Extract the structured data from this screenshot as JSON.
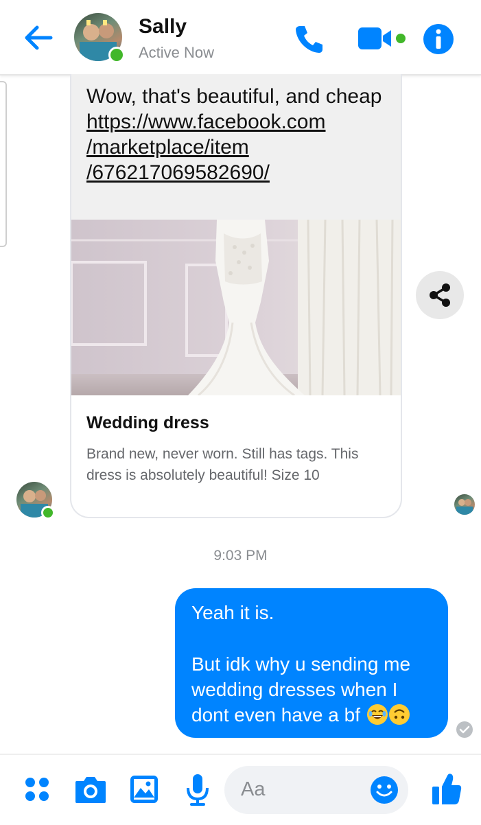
{
  "header": {
    "contact_name": "Sally",
    "status": "Active Now",
    "back_icon": "back-arrow-icon",
    "call_icon": "phone-icon",
    "video_icon": "video-camera-icon",
    "info_icon": "info-icon",
    "accent_color": "#0084ff",
    "online_color": "#42b72a"
  },
  "received_message": {
    "text": "Wow, that's beautiful, and cheap",
    "link_lines": [
      "https://www.facebook.com",
      "/marketplace/item",
      "/676217069582690/"
    ],
    "link_preview": {
      "title": "Wedding dress",
      "description": "Brand new, never worn. Still has tags. This dress is absolutely beautiful! Size 10"
    }
  },
  "share_icon": "share-icon",
  "timestamp": "9:03 PM",
  "sent_message": {
    "lines": [
      "Yeah it is.",
      "",
      "But idk why u sending me",
      "wedding dresses when I",
      "dont even have a bf"
    ],
    "emojis": [
      "😂",
      "🙃"
    ],
    "bubble_color": "#0084ff"
  },
  "composer": {
    "placeholder": "Aa",
    "icons": [
      "apps-icon",
      "camera-icon",
      "gallery-icon",
      "microphone-icon",
      "emoji-icon",
      "thumbs-up-icon"
    ]
  }
}
